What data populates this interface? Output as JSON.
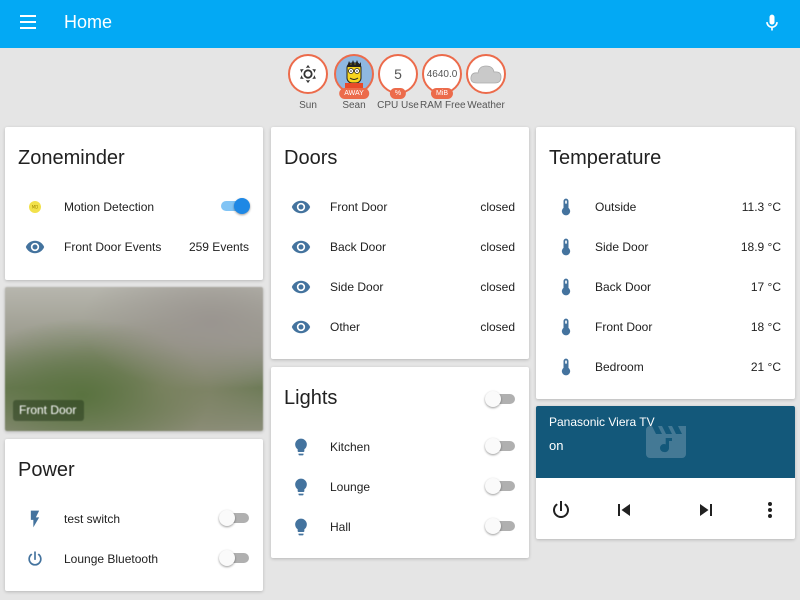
{
  "header": {
    "title": "Home",
    "menu_icon": "menu-icon",
    "mic_icon": "microphone-icon"
  },
  "badges": [
    {
      "label": "Sun",
      "icon": "sun-icon",
      "value": ""
    },
    {
      "label": "Sean",
      "icon": "avatar",
      "unit": "AWAY"
    },
    {
      "label": "CPU Use",
      "value": "5",
      "unit": "%"
    },
    {
      "label": "RAM Free",
      "value": "4640.0",
      "unit": "MiB"
    },
    {
      "label": "Weather",
      "icon": "cloud-icon"
    }
  ],
  "zoneminder": {
    "title": "Zoneminder",
    "rows": [
      {
        "name": "Motion Detection",
        "icon": "motion-icon",
        "toggle": true
      },
      {
        "name": "Front Door Events",
        "icon": "eye-icon",
        "value": "259 Events"
      }
    ]
  },
  "camera": {
    "caption": "Front Door"
  },
  "power": {
    "title": "Power",
    "rows": [
      {
        "name": "test switch",
        "icon": "flash-icon",
        "toggle": false
      },
      {
        "name": "Lounge Bluetooth",
        "icon": "power-icon",
        "toggle": false
      }
    ]
  },
  "doors": {
    "title": "Doors",
    "rows": [
      {
        "name": "Front Door",
        "icon": "eye-icon",
        "value": "closed"
      },
      {
        "name": "Back Door",
        "icon": "eye-icon",
        "value": "closed"
      },
      {
        "name": "Side Door",
        "icon": "eye-icon",
        "value": "closed"
      },
      {
        "name": "Other",
        "icon": "eye-icon",
        "value": "closed"
      }
    ]
  },
  "lights": {
    "title": "Lights",
    "group_toggle": false,
    "rows": [
      {
        "name": "Kitchen",
        "icon": "lightbulb-icon",
        "toggle": false
      },
      {
        "name": "Lounge",
        "icon": "lightbulb-icon",
        "toggle": false
      },
      {
        "name": "Hall",
        "icon": "lightbulb-icon",
        "toggle": false
      }
    ]
  },
  "temperature": {
    "title": "Temperature",
    "rows": [
      {
        "name": "Outside",
        "icon": "thermometer-icon",
        "value": "11.3 °C"
      },
      {
        "name": "Side Door",
        "icon": "thermometer-icon",
        "value": "18.9 °C"
      },
      {
        "name": "Back Door",
        "icon": "thermometer-icon",
        "value": "17 °C"
      },
      {
        "name": "Front Door",
        "icon": "thermometer-icon",
        "value": "18 °C"
      },
      {
        "name": "Bedroom",
        "icon": "thermometer-icon",
        "value": "21 °C"
      }
    ]
  },
  "media_player": {
    "name": "Panasonic Viera TV",
    "state": "on",
    "controls": [
      "power-icon",
      "skip-previous-icon",
      "skip-next-icon",
      "more-vert-icon"
    ]
  },
  "colors": {
    "header": "#03a9f4",
    "icon": "#44739e",
    "badge_border": "#ec6b4b",
    "toggle_on": "#1e88e5",
    "media_bg": "#13587a"
  }
}
